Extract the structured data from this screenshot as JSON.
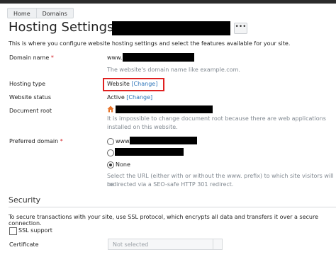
{
  "breadcrumb": {
    "items": [
      "Home",
      "Domains"
    ]
  },
  "page": {
    "title": "Hosting Settings for",
    "more_label": "•••",
    "intro": "This is where you configure website hosting settings and select the features available for your site."
  },
  "form": {
    "domain_name": {
      "label": "Domain name",
      "required_mark": "*",
      "prefix": "www.",
      "hint": "The website's domain name like example.com."
    },
    "hosting_type": {
      "label": "Hosting type",
      "value": "Website",
      "change": "[Change]"
    },
    "website_status": {
      "label": "Website status",
      "value": "Active",
      "change": "[Change]"
    },
    "document_root": {
      "label": "Document root",
      "hint_line1": "It is impossible to change document root because there are web applications",
      "hint_line2": "installed on this website."
    },
    "preferred_domain": {
      "label": "Preferred domain",
      "required_mark": "*",
      "option1_prefix": "www.",
      "option3": "None",
      "selected": "None",
      "hint_line1": "Select the URL (either with or without the www. prefix) to which site visitors will be",
      "hint_line2": "redirected via a SEO-safe HTTP 301 redirect."
    }
  },
  "security": {
    "title": "Security",
    "description": "To secure transactions with your site, use SSL protocol, which encrypts all data and transfers it over a secure connection.",
    "ssl_label": "SSL support",
    "certificate_label": "Certificate",
    "certificate_value": "Not selected"
  },
  "colors": {
    "link": "#2a73b9",
    "highlight": "#e02020",
    "required": "#d4252b"
  }
}
